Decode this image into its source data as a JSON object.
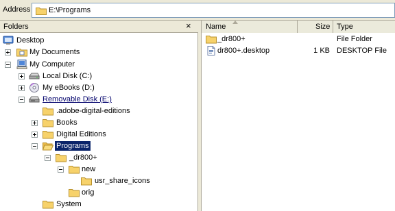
{
  "address": {
    "label": "Address",
    "path": "E:\\Programs"
  },
  "folders_pane": {
    "title": "Folders",
    "close_glyph": "×",
    "tree": [
      {
        "label": "Desktop",
        "icon": "desktop-icon",
        "expander": "none",
        "level": 0
      },
      {
        "label": "My Documents",
        "icon": "folder-icon",
        "expander": "plus",
        "level": 1
      },
      {
        "label": "My Computer",
        "icon": "computer-icon",
        "expander": "minus",
        "level": 1
      },
      {
        "label": "Local Disk (C:)",
        "icon": "hard-disk-icon",
        "expander": "plus",
        "level": 2
      },
      {
        "label": "My eBooks (D:)",
        "icon": "cd-drive-icon",
        "expander": "plus",
        "level": 2
      },
      {
        "label": "Removable Disk (E:)",
        "icon": "removable-disk-icon",
        "expander": "minus",
        "level": 2
      },
      {
        "label": ".adobe-digital-editions",
        "icon": "folder-icon",
        "expander": "none",
        "level": 3
      },
      {
        "label": "Books",
        "icon": "folder-icon",
        "expander": "plus",
        "level": 3
      },
      {
        "label": "Digital Editions",
        "icon": "folder-icon",
        "expander": "plus",
        "level": 3
      },
      {
        "label": "Programs",
        "icon": "open-folder-icon",
        "expander": "minus",
        "level": 3,
        "selected": true
      },
      {
        "label": "_dr800+",
        "icon": "folder-icon",
        "expander": "minus",
        "level": 4
      },
      {
        "label": "new",
        "icon": "folder-icon",
        "expander": "minus",
        "level": 5
      },
      {
        "label": "usr_share_icons",
        "icon": "folder-icon",
        "expander": "none",
        "level": 6
      },
      {
        "label": "orig",
        "icon": "folder-icon",
        "expander": "none",
        "level": 5
      },
      {
        "label": "System",
        "icon": "folder-icon",
        "expander": "none",
        "level": 3
      }
    ]
  },
  "list_pane": {
    "columns": {
      "name": "Name",
      "size": "Size",
      "type": "Type"
    },
    "sort_column": "name",
    "rows": [
      {
        "name": "_dr800+",
        "size": "",
        "type": "File Folder",
        "icon": "folder-icon"
      },
      {
        "name": "dr800+.desktop",
        "size": "1 KB",
        "type": "DESKTOP File",
        "icon": "file-icon"
      }
    ]
  },
  "colors": {
    "chrome": "#ece9d8",
    "selection": "#0a246a",
    "folder_yellow": "#f7d26b",
    "link_blue": "#00006b"
  }
}
